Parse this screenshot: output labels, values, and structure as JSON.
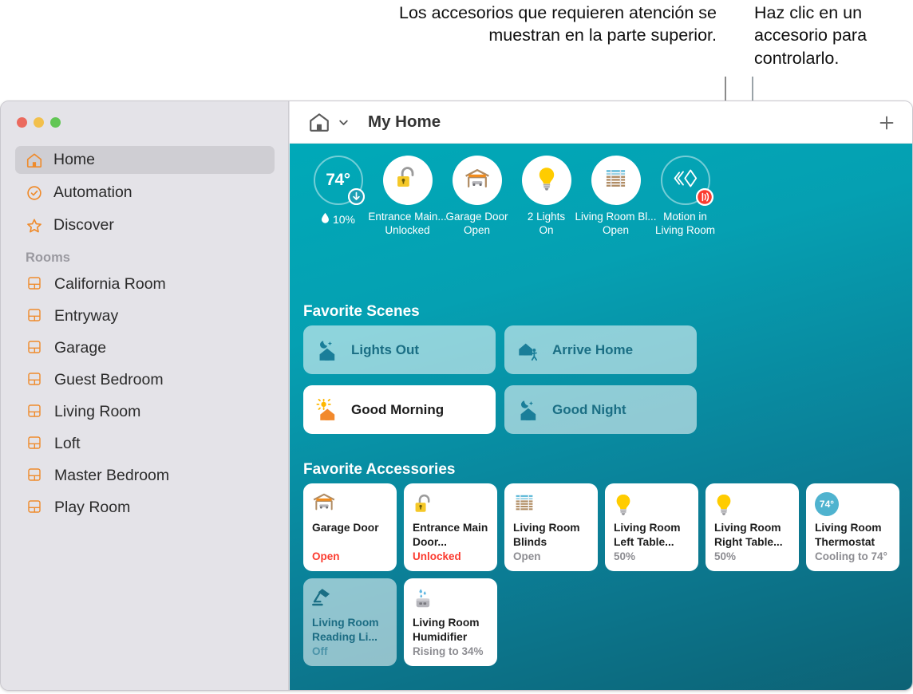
{
  "annotations": {
    "left": "Los accesorios que requieren atención se muestran en la parte superior.",
    "right": "Haz clic en un accesorio para controlarlo."
  },
  "window": {
    "traffic_lights": [
      "close-red",
      "minimize-yellow",
      "maximize-green"
    ]
  },
  "sidebar": {
    "nav": [
      {
        "label": "Home",
        "icon": "house-icon",
        "selected": true
      },
      {
        "label": "Automation",
        "icon": "clock-check-icon",
        "selected": false
      },
      {
        "label": "Discover",
        "icon": "star-icon",
        "selected": false
      }
    ],
    "rooms_header": "Rooms",
    "rooms": [
      {
        "label": "California Room",
        "icon": "room-icon"
      },
      {
        "label": "Entryway",
        "icon": "room-icon"
      },
      {
        "label": "Garage",
        "icon": "room-icon"
      },
      {
        "label": "Guest Bedroom",
        "icon": "room-icon"
      },
      {
        "label": "Living Room",
        "icon": "room-icon"
      },
      {
        "label": "Loft",
        "icon": "room-icon"
      },
      {
        "label": "Master Bedroom",
        "icon": "room-icon"
      },
      {
        "label": "Play Room",
        "icon": "room-icon"
      }
    ]
  },
  "toolbar": {
    "home_icon": "house-icon",
    "chevron_icon": "chevron-down-icon",
    "title": "My Home",
    "add_icon": "plus-icon"
  },
  "status_strip": [
    {
      "kind": "temperature",
      "temp": "74°",
      "humidity": "10%",
      "humidity_icon": "water-drop-icon",
      "badge": "arrow-down-icon"
    },
    {
      "kind": "accessory",
      "icon": "unlocked-padlock-icon",
      "name": "Entrance Main...",
      "state": "Unlocked"
    },
    {
      "kind": "accessory",
      "icon": "garage-door-icon",
      "name": "Garage Door",
      "state": "Open"
    },
    {
      "kind": "accessory",
      "icon": "lightbulb-icon",
      "name": "2 Lights",
      "state": "On"
    },
    {
      "kind": "accessory",
      "icon": "blinds-icon",
      "name": "Living Room Bl...",
      "state": "Open"
    },
    {
      "kind": "sensor",
      "icon": "motion-sensor-icon",
      "badge": "motion-waves-icon",
      "name": "Motion in",
      "state": "Living Room"
    }
  ],
  "scenes": {
    "title": "Favorite Scenes",
    "items": [
      {
        "label": "Lights Out",
        "icon": "moon-house-icon",
        "active": false
      },
      {
        "label": "Arrive Home",
        "icon": "house-walk-icon",
        "active": false
      },
      {
        "label": "Good Morning",
        "icon": "sun-house-icon",
        "active": true
      },
      {
        "label": "Good Night",
        "icon": "moon-house-icon",
        "active": false
      }
    ]
  },
  "accessories": {
    "title": "Favorite Accessories",
    "items": [
      {
        "icon": "garage-door-icon",
        "name": "Garage Door",
        "state": "Open",
        "alert": true,
        "dim": false
      },
      {
        "icon": "unlocked-padlock-icon",
        "name": "Entrance Main Door...",
        "state": "Unlocked",
        "alert": true,
        "dim": false
      },
      {
        "icon": "blinds-icon",
        "name": "Living Room Blinds",
        "state": "Open",
        "alert": false,
        "dim": false
      },
      {
        "icon": "lightbulb-icon",
        "name": "Living Room Left Table...",
        "state": "50%",
        "alert": false,
        "dim": false
      },
      {
        "icon": "lightbulb-icon",
        "name": "Living Room Right Table...",
        "state": "50%",
        "alert": false,
        "dim": false
      },
      {
        "icon": "thermostat-pill-icon",
        "name": "Living Room Thermostat",
        "state": "Cooling to 74°",
        "alert": false,
        "dim": false,
        "pill_temp": "74°"
      },
      {
        "icon": "desk-lamp-icon",
        "name": "Living Room Reading Li...",
        "state": "Off",
        "alert": false,
        "dim": true
      },
      {
        "icon": "humidifier-icon",
        "name": "Living Room Humidifier",
        "state": "Rising to 34%",
        "alert": false,
        "dim": false
      }
    ]
  },
  "colors": {
    "accent_orange": "#ef8b2c",
    "teal_top": "#00a9b8",
    "teal_bottom": "#0d6275",
    "alert_red": "#fb3b2f",
    "scene_text": "#1a6e84",
    "lightbulb_yellow": "#ffcc00"
  }
}
